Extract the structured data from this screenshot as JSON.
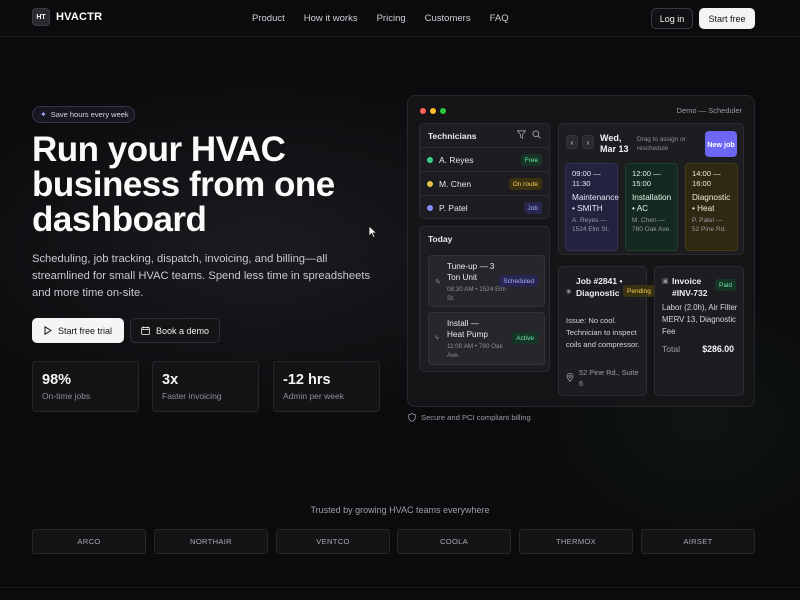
{
  "nav": {
    "logo_mark": "HT",
    "brand": "HVACTR",
    "links": [
      "Product",
      "How it works",
      "Pricing",
      "Customers",
      "FAQ"
    ],
    "login": "Log in",
    "start_free": "Start free"
  },
  "hero": {
    "badge": "Save hours every week",
    "title_lines": [
      "Run your HVAC",
      "business from one",
      "dashboard"
    ],
    "subtitle": "Scheduling, job tracking, dispatch, invoicing, and billing—all streamlined for small HVAC teams. Spend less time in spreadsheets and more time on-site.",
    "cta_trial": "Start free trial",
    "cta_demo": "Book a demo",
    "stats": [
      {
        "value": "98%",
        "label": "On-time jobs"
      },
      {
        "value": "3x",
        "label": "Faster invoicing"
      },
      {
        "value": "-12 hrs",
        "label": "Admin per week"
      }
    ]
  },
  "app": {
    "window_title": "Demo — Scheduler",
    "technicians": {
      "title": "Technicians",
      "rows": [
        {
          "name": "A. Reyes",
          "status": "Free",
          "dot_color": "#3ecf8e",
          "pill_bg": "#163526",
          "pill_fg": "#6ee7a8"
        },
        {
          "name": "M. Chen",
          "status": "On route",
          "dot_color": "#e5c04a",
          "pill_bg": "#3a3110",
          "pill_fg": "#f0cf5a"
        },
        {
          "name": "P. Patel",
          "status": "Job",
          "dot_color": "#8b8cf7",
          "pill_bg": "#262650",
          "pill_fg": "#a9aaff"
        }
      ]
    },
    "today": {
      "title": "Today",
      "jobs": [
        {
          "title": "Tune-up — 3 Ton Unit",
          "meta": "08:30 AM • 1524 Elm St.",
          "status": "Scheduled",
          "pill_bg": "#262650",
          "pill_fg": "#a9aaff"
        },
        {
          "title": "Install — Heat Pump",
          "meta": "11:00 AM • 780 Oak Ave.",
          "status": "Active",
          "pill_bg": "#163526",
          "pill_fg": "#6ee7a8"
        }
      ]
    },
    "schedule": {
      "date": "Wed, Mar 13",
      "hint": "Drag to assign or reschedule",
      "new_job": "New job",
      "slots": [
        {
          "time": "09:00 — 11:30",
          "title": "Maintenance • SMITH",
          "meta": "A. Reyes — 1524 Elm St.",
          "bg": "#23233f",
          "border": "#32325a",
          "fg": "#e6e6f5"
        },
        {
          "time": "12:00 — 15:00",
          "title": "Installation • AC",
          "meta": "M. Chen — 780 Oak Ave.",
          "bg": "#14291f",
          "border": "#1f3d2e",
          "fg": "#e3f2ea"
        },
        {
          "time": "14:00 — 16:00",
          "title": "Diagnostic • Heat",
          "meta": "P. Patel — 52 Pine Rd.",
          "bg": "#2f2812",
          "border": "#473b17",
          "fg": "#f3ead0"
        }
      ]
    },
    "job_detail": {
      "title": "Job #2841 • Diagnostic",
      "status": "Pending",
      "issue": "Issue: No cool. Technician to inspect coils and compressor.",
      "address": "52 Pine Rd., Suite 6"
    },
    "invoice": {
      "title": "Invoice #INV-732",
      "status": "Paid",
      "items": "Labor (2.0h), Air Filter MERV 13, Diagnostic Fee",
      "total_label": "Total",
      "total_value": "$286.00"
    }
  },
  "footnote": "Secure and PCI compliant billing",
  "trusted": {
    "title": "Trusted by growing HVAC teams everywhere",
    "logos": [
      "ARCO",
      "NORTHAIR",
      "VENTCO",
      "COOLA",
      "THERMOX",
      "AIRSET"
    ]
  }
}
